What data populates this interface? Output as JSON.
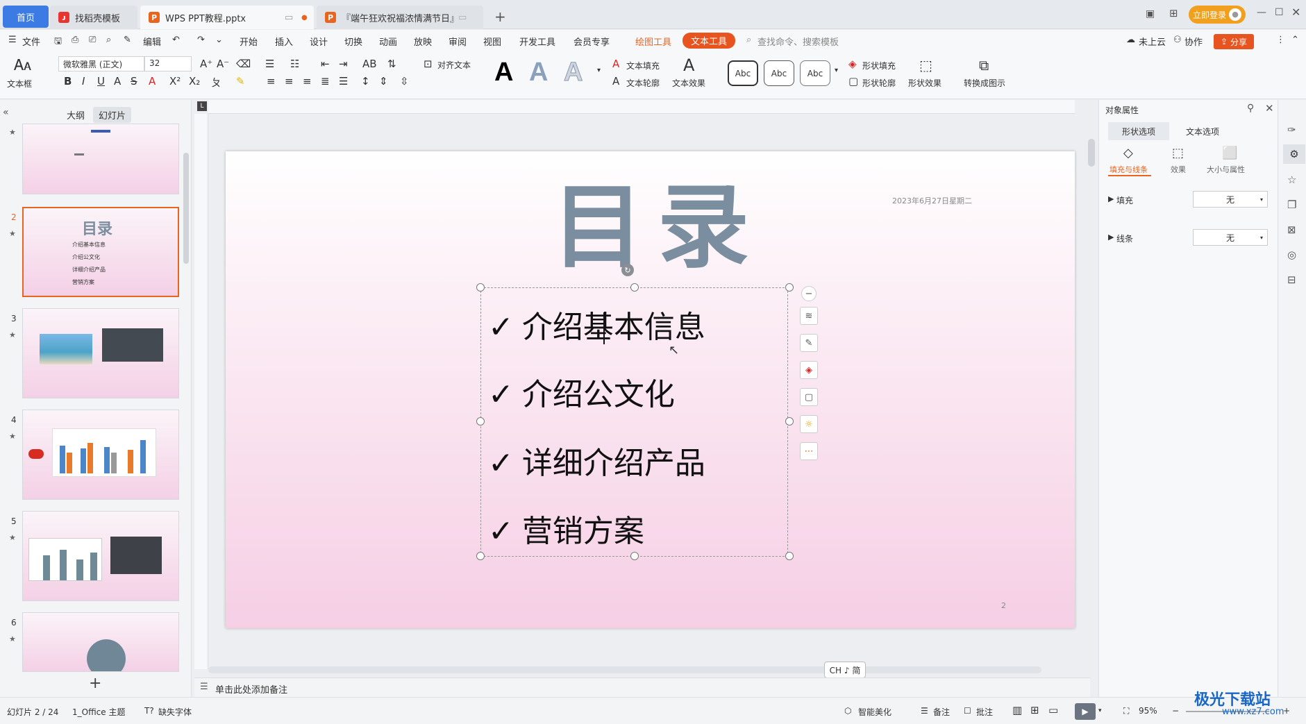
{
  "tabs": {
    "home": "首页",
    "find": "找稻壳模板",
    "wps": "WPS PPT教程.pptx",
    "dw": "『端午狂欢祝福浓情满节日』",
    "login": "立即登录"
  },
  "menu": {
    "file": "文件",
    "edit": "编辑",
    "start": "开始",
    "insert": "插入",
    "design": "设计",
    "switch": "切换",
    "anim": "动画",
    "play": "放映",
    "review": "审阅",
    "view": "视图",
    "dev": "开发工具",
    "member": "会员专享",
    "draw": "绘图工具",
    "text": "文本工具",
    "search": "查找命令、搜索模板",
    "cloud": "未上云",
    "collab": "协作",
    "share": "分享"
  },
  "ribbon": {
    "textbox": "文本框",
    "font": "微软雅黑 (正文)",
    "size": "32",
    "align_text": "对齐文本",
    "text_fill": "文本填充",
    "text_outline": "文本轮廓",
    "text_effect": "文本效果",
    "abc": "Abc",
    "shape_fill": "形状填充",
    "shape_outline": "形状轮廓",
    "shape_effect": "形状效果",
    "convert": "转换成图示"
  },
  "left": {
    "outline": "大纲",
    "slides": "幻灯片",
    "nums": [
      "2",
      "3",
      "4",
      "5",
      "6"
    ]
  },
  "slide": {
    "title": "目录",
    "date": "2023年6月27日星期二",
    "page": "2",
    "check": "✓",
    "bullets": [
      "介绍基本信息",
      "介绍公文化",
      "详细介绍产品",
      "营销方案"
    ]
  },
  "right": {
    "header": "对象属性",
    "tab_shape": "形状选项",
    "tab_text": "文本选项",
    "sub_fill": "填充与线条",
    "sub_effect": "效果",
    "sub_size": "大小与属性",
    "fill": "填充",
    "line": "线条",
    "none": "无"
  },
  "bottom": {
    "notes": "单击此处添加备注",
    "slide_count": "幻灯片 2 / 24",
    "theme": "1_Office 主题",
    "missing_font": "缺失字体",
    "beautify": "智能美化",
    "remarks": "备注",
    "comment": "批注",
    "zoom": "95%",
    "ime": "CH ♪ 简"
  },
  "watermark": {
    "name": "极光下载站",
    "url": "www.xz7.com"
  },
  "colors": {
    "accent": "#e8641f",
    "home_tab": "#3c7be3",
    "title_gray": "#7a8ea0"
  }
}
